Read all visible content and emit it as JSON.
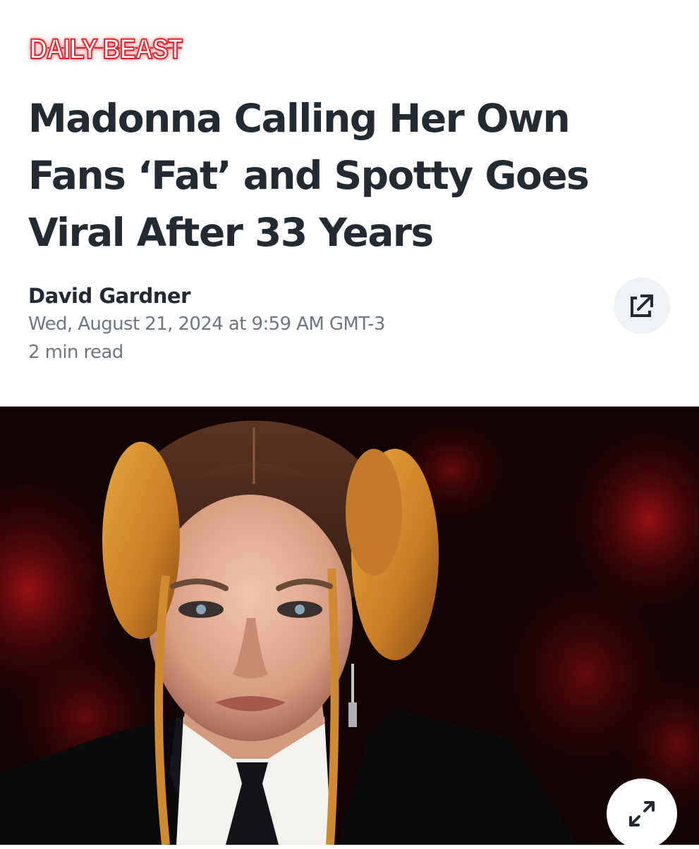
{
  "publisher": {
    "logo_text": "DAILY BEAST",
    "brand_color": "#e0242b"
  },
  "article": {
    "headline": "Madonna Calling Her Own Fans ‘Fat’ and Spotty Goes Viral After 33 Years",
    "author": "David Gardner",
    "published": "Wed, August 21, 2024 at 9:59 AM GMT-3",
    "read_time": "2 min read"
  },
  "actions": {
    "share_icon": "external-link-icon",
    "expand_icon": "expand-arrows-icon"
  },
  "hero_image": {
    "subject": "photo"
  },
  "colors": {
    "headline_text": "#232a31",
    "meta_text": "#6e7780",
    "share_button_bg": "#f0f3f5"
  }
}
